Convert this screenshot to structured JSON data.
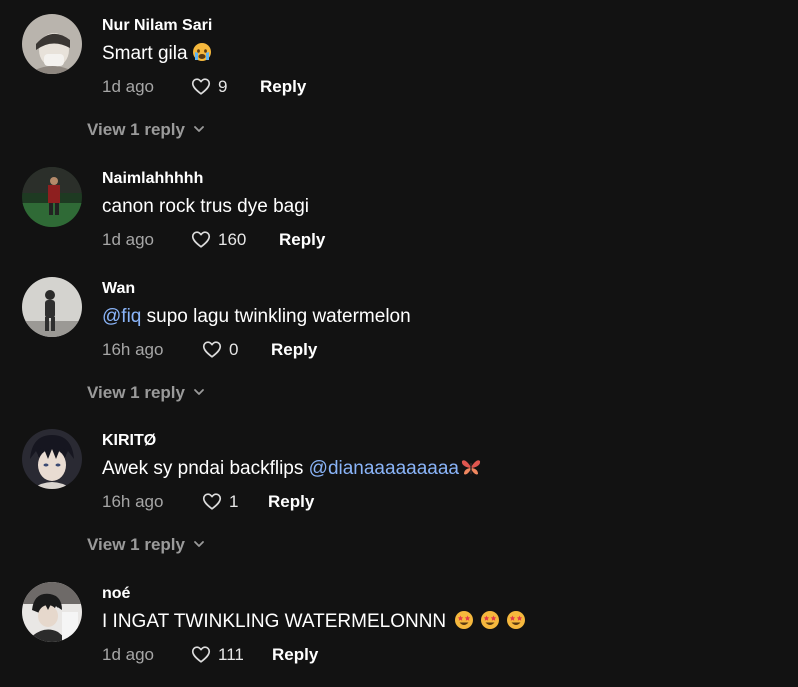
{
  "comments": [
    {
      "username": "Nur Nilam Sari",
      "text": "Smart gila",
      "emoji": "crying-face",
      "time": "1d ago",
      "likes": "9",
      "reply_label": "Reply",
      "view_replies": "View 1 reply"
    },
    {
      "username": "Naimlahhhhh",
      "text": "canon rock trus dye bagi",
      "time": "1d ago",
      "likes": "160",
      "reply_label": "Reply"
    },
    {
      "username": "Wan",
      "mention": "@fiq",
      "text": " supo lagu twinkling watermelon",
      "time": "16h ago",
      "likes": "0",
      "reply_label": "Reply",
      "view_replies": "View 1 reply"
    },
    {
      "username": "KIRITØ",
      "text": "Awek sy pndai backflips ",
      "mention": "@dianaaaaaaaaa",
      "emoji": "butterfly",
      "time": "16h ago",
      "likes": "1",
      "reply_label": "Reply",
      "view_replies": "View 1 reply"
    },
    {
      "username": "noé",
      "text": "I INGAT TWINKLING WATERMELONNN",
      "emoji": "star-struck",
      "time": "1d ago",
      "likes": "111",
      "reply_label": "Reply"
    }
  ],
  "colors": {
    "background": "#121212",
    "mention": "#8ab4f8",
    "muted": "#a6a6a6"
  }
}
